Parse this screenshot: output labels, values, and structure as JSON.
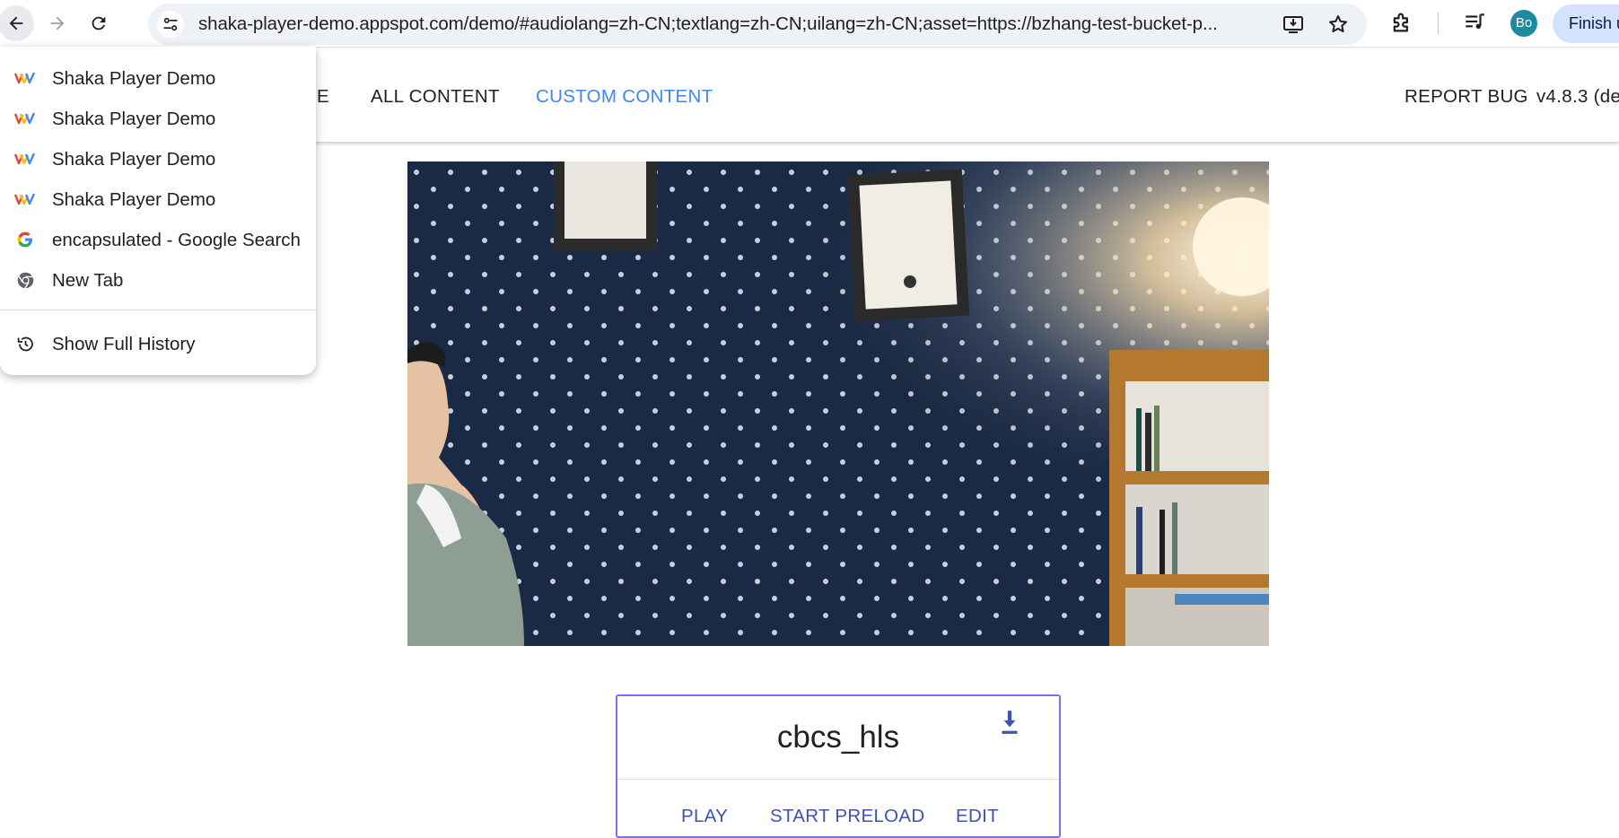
{
  "browser": {
    "url": "shaka-player-demo.appspot.com/demo/#audiolang=zh-CN;textlang=zh-CN;uilang=zh-CN;asset=https://bzhang-test-bucket-p...",
    "profile_initials": "Bo",
    "finish_label": "Finish u",
    "accent": "#d3e3fd"
  },
  "history_menu": {
    "items": [
      {
        "label": "Shaka Player Demo",
        "icon": "shaka-logo-icon"
      },
      {
        "label": "Shaka Player Demo",
        "icon": "shaka-logo-icon"
      },
      {
        "label": "Shaka Player Demo",
        "icon": "shaka-logo-icon"
      },
      {
        "label": "Shaka Player Demo",
        "icon": "shaka-logo-icon"
      },
      {
        "label": "encapsulated - Google Search",
        "icon": "google-icon"
      },
      {
        "label": "New Tab",
        "icon": "chrome-icon"
      }
    ],
    "show_full_history": "Show Full History"
  },
  "app_nav": {
    "partial_link": "E",
    "all_content": "ALL CONTENT",
    "custom_content": "CUSTOM CONTENT",
    "report_bug": "REPORT BUG",
    "version": "v4.8.3 (de",
    "active_color": "#4285f4"
  },
  "asset_card": {
    "title": "cbcs_hls",
    "play": "PLAY",
    "start_preload": "START PRELOAD",
    "edit": "EDIT",
    "accent": "#3f51b5"
  }
}
